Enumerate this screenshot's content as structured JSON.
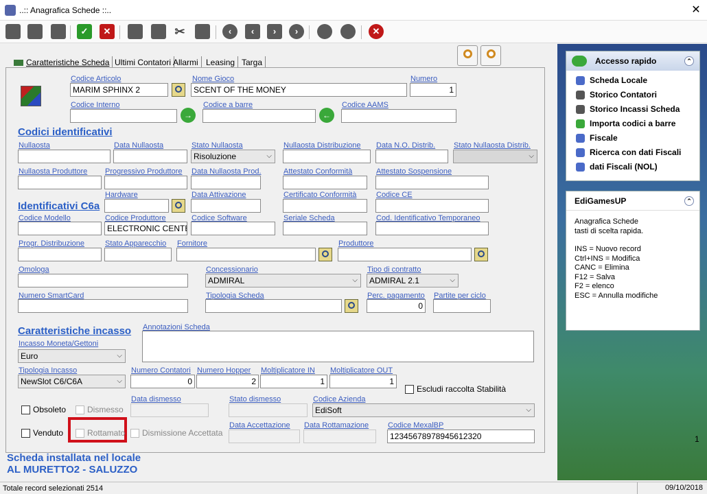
{
  "window": {
    "title": "..:: Anagrafica Schede ::..",
    "close": "✕"
  },
  "toolbar": {
    "icons": [
      "copy-icon",
      "open-icon",
      "paste-icon",
      "save-check-icon",
      "delete-icon",
      "print-icon",
      "print-preview-icon",
      "cut-icon",
      "stamp-icon",
      "first-icon",
      "prev-icon",
      "next-icon",
      "last-icon",
      "search-icon",
      "refresh-icon",
      "close-icon"
    ]
  },
  "tabs": [
    {
      "label": "Caratteristiche Scheda"
    },
    {
      "label": "Ultimi Contatori"
    },
    {
      "label": "Allarmi"
    },
    {
      "label": "Leasing"
    },
    {
      "label": "Targa"
    }
  ],
  "labels": {
    "codice_articolo": "Codice Articolo",
    "nome_gioco": "Nome Gioco",
    "numero": "Numero",
    "codice_interno": "Codice Interno",
    "codice_a_barre": "Codice a barre",
    "codice_aams": "Codice AAMS",
    "codici_identificativi": "Codici identificativi",
    "nullaosta": "Nullaosta",
    "data_nullaosta": "Data Nullaosta",
    "stato_nullaosta": "Stato Nullaosta",
    "nullaosta_distribuzione": "Nullaosta Distribuzione",
    "data_no_distrib": "Data N.O. Distrib.",
    "stato_nullaosta_distrib": "Stato Nullaosta Distrib.",
    "nullaosta_produttore": "Nullaosta Produttore",
    "progressivo_produttore": "Progressivo Produttore",
    "data_nullaosta_prod": "Data Nullaosta Prod.",
    "attestato_conformita": "Attestato Conformità",
    "attestato_sospensione": "Attestato Sospensione",
    "hardware": "Hardware",
    "data_attivazione": "Data Attivazione",
    "certificato_conformita": "Certificato Conformità",
    "codice_ce": "Codice CE",
    "identificativi_c6a": "Identificativi C6a",
    "codice_modello": "Codice Modello",
    "codice_produttore": "Codice Produttore",
    "codice_software": "Codice Software",
    "seriale_scheda": "Seriale Scheda",
    "cod_identificativo_temporaneo": "Cod. Identificativo Temporaneo",
    "progr_distribuzione": "Progr. Distribuzione",
    "stato_apparecchio": "Stato Apparecchio",
    "fornitore": "Fornitore",
    "produttore": "Produttore",
    "omologa": "Omologa",
    "concessionario": "Concessionario",
    "tipo_contratto": "Tipo di contratto",
    "numero_smartcard": "Numero SmartCard",
    "tipologia_scheda": "Tipologia Scheda",
    "perc_pagamento": "Perc. pagamento",
    "partite_per_ciclo": "Partite per ciclo",
    "caratteristiche_incasso": "Caratteristiche incasso",
    "annotazioni_scheda": "Annotazioni Scheda",
    "incasso_moneta": "Incasso Moneta/Gettoni",
    "tipologia_incasso": "Tipologia Incasso",
    "numero_contatori": "Numero Contatori",
    "numero_hopper": "Numero Hopper",
    "moltiplicatore_in": "Moltiplicatore IN",
    "moltiplicatore_out": "Moltiplicatore OUT",
    "data_dismesso": "Data dismesso",
    "stato_dismesso": "Stato dismesso",
    "codice_azienda": "Codice Azienda",
    "data_accettazione": "Data Accettazione",
    "data_rottamazione": "Data Rottamazione",
    "codice_mexalbp": "Codice MexalBP"
  },
  "values": {
    "codice_articolo": "MARIM SPHINX 2",
    "nome_gioco": "SCENT OF THE MONEY",
    "numero": "1",
    "stato_nullaosta": "Risoluzione",
    "codice_produttore": "ELECTRONIC CENTEF",
    "concessionario": "ADMIRAL",
    "tipo_contratto": "ADMIRAL 2.1",
    "perc_pagamento": "0",
    "incasso_moneta": "Euro",
    "tipologia_incasso": "NewSlot C6/C6A",
    "numero_contatori": "0",
    "numero_hopper": "2",
    "moltiplicatore_in": "1",
    "moltiplicatore_out": "1",
    "codice_azienda": "EdiSoft",
    "codice_mexalbp": "12345678978945612320"
  },
  "checkboxes": {
    "escludi": "Escludi raccolta Stabilità",
    "obsoleto": "Obsoleto",
    "dismesso": "Dismesso",
    "venduto": "Venduto",
    "rottamato": "Rottamato",
    "dismissione_accettata": "Dismissione Accettata"
  },
  "installed": {
    "line1": "Scheda installata nel locale",
    "line2": "AL MURETTO2 - SALUZZO"
  },
  "quick": {
    "title": "Accesso rapido",
    "items": [
      "Scheda Locale",
      "Storico Contatori",
      "Storico Incassi Scheda",
      "Importa codici a barre",
      "Fiscale",
      "Ricerca con dati Fiscali",
      "dati Fiscali (NOL)"
    ]
  },
  "edigames": {
    "title": "EdiGamesUP",
    "lines": [
      "Anagrafica Schede",
      "tasti di scelta rapida.",
      "",
      "INS = Nuovo record",
      "Ctrl+INS = Modifica",
      "CANC = Elimina",
      "F12 = Salva",
      "F2 = elenco",
      "ESC = Annulla modifiche"
    ]
  },
  "right_number": "1",
  "status": {
    "left": "Totale record selezionati 2514",
    "right": "09/10/2018"
  },
  "colors": {
    "highlight": "#d0101a",
    "section": "#2b5fc6",
    "label": "#3a5cbf"
  }
}
